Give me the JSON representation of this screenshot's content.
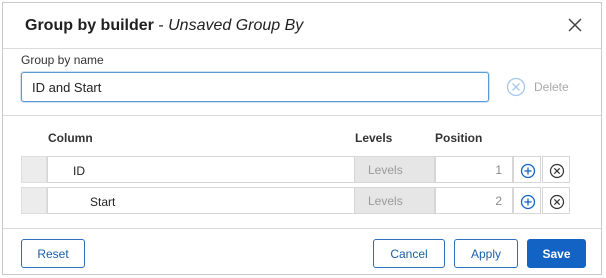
{
  "dialog": {
    "title_bold": "Group by builder",
    "title_sep": " - ",
    "title_italic": "Unsaved Group By"
  },
  "name": {
    "label": "Group by name",
    "value": "ID and Start",
    "delete_label": "Delete"
  },
  "columns": {
    "column": "Column",
    "levels": "Levels",
    "position": "Position"
  },
  "rows": [
    {
      "column": "ID",
      "indent_level": 1,
      "levels": "Levels",
      "position": "1"
    },
    {
      "column": "Start",
      "indent_level": 2,
      "levels": "Levels",
      "position": "2"
    }
  ],
  "footer": {
    "reset": "Reset",
    "cancel": "Cancel",
    "apply": "Apply",
    "save": "Save"
  },
  "colors": {
    "accent": "#1363c4",
    "input_border": "#5b9bd5"
  }
}
